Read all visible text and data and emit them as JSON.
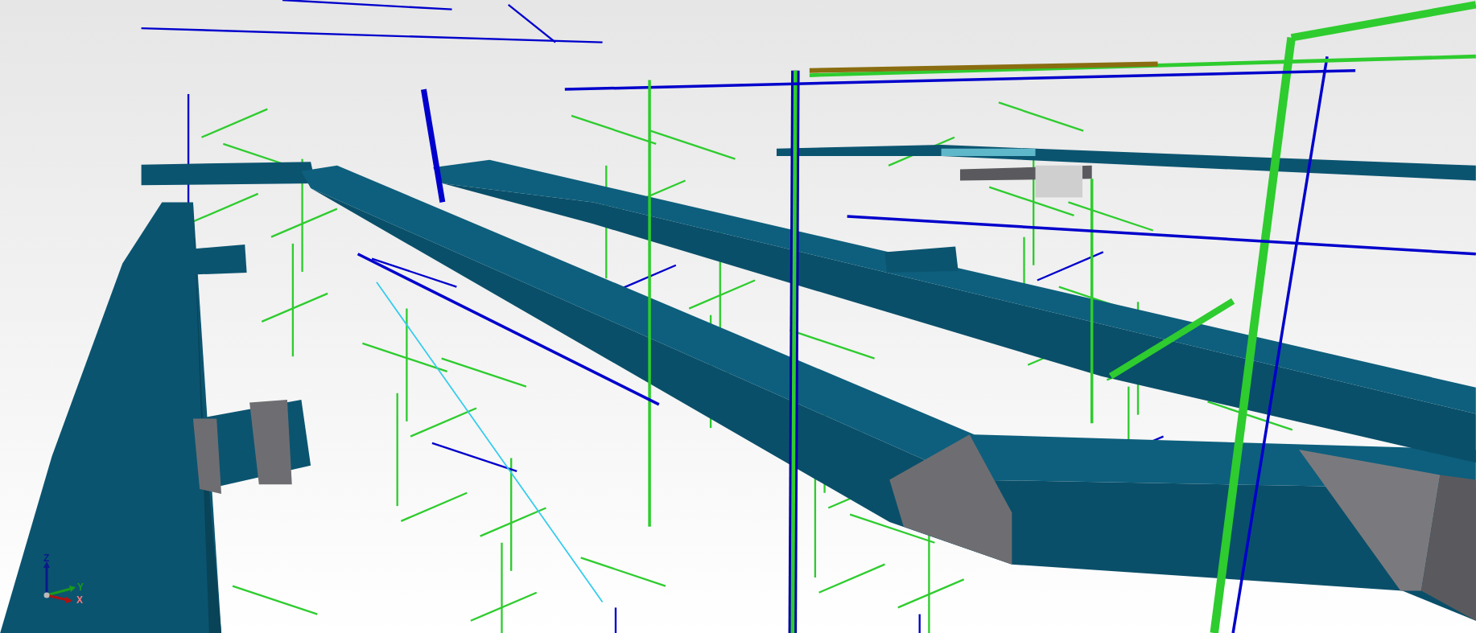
{
  "viewport": {
    "axis_triad": {
      "labels": [
        {
          "kind": "z",
          "text": "Z"
        },
        {
          "kind": "y",
          "text": "Y"
        },
        {
          "kind": "x",
          "text": "X"
        }
      ]
    }
  }
}
